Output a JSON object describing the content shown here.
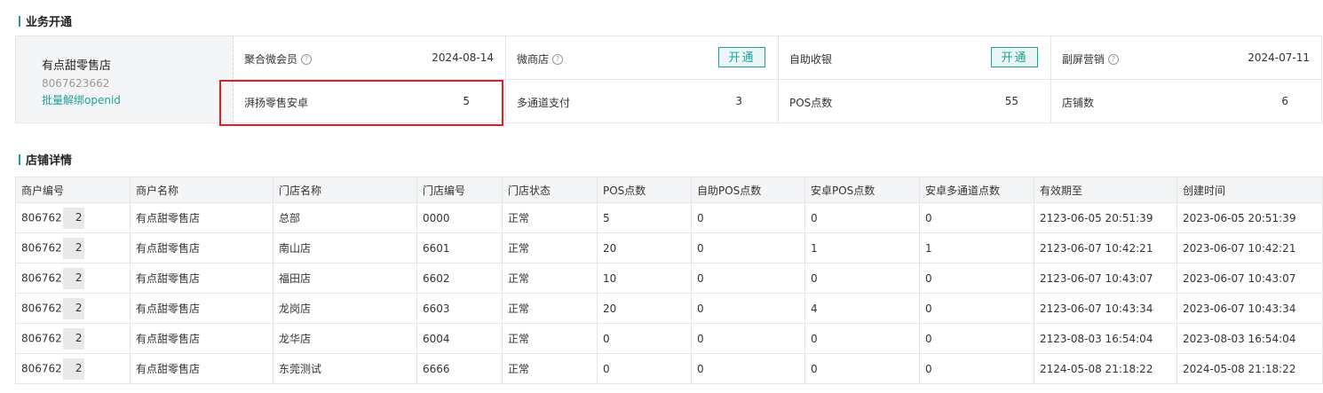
{
  "business": {
    "title": "业务开通",
    "store": {
      "name": "有点甜零售店",
      "id": "8067623662",
      "link": "批量解绑openid"
    },
    "items": [
      {
        "label": "聚合微会员",
        "value": "2024-08-14",
        "help": true
      },
      {
        "label": "微商店",
        "button": "开通",
        "help": true
      },
      {
        "label": "自助收银",
        "button": "开通"
      },
      {
        "label": "副屏营销",
        "value": "2024-07-11",
        "help": true
      },
      {
        "label": "湃扬零售安卓",
        "value": "5"
      },
      {
        "label": "多通道支付",
        "value": "3"
      },
      {
        "label": "POS点数",
        "value": "55"
      },
      {
        "label": "店铺数",
        "value": "6"
      }
    ]
  },
  "details": {
    "title": "店铺详情",
    "columns": [
      "商户编号",
      "商户名称",
      "门店名称",
      "门店编号",
      "门店状态",
      "POS点数",
      "自助POS点数",
      "安卓POS点数",
      "安卓多通道点数",
      "有效期至",
      "创建时间"
    ],
    "rows": [
      {
        "merchant_no": "806762",
        "merchant_no_tail": "2",
        "merchant_name": "有点甜零售店",
        "store_name": "总部",
        "store_no": "0000",
        "status": "正常",
        "pos": "5",
        "self_pos": "0",
        "android_pos": "0",
        "android_multi": "0",
        "valid_until": "2123-06-05 20:51:39",
        "created": "2023-06-05 20:51:39"
      },
      {
        "merchant_no": "806762",
        "merchant_no_tail": "2",
        "merchant_name": "有点甜零售店",
        "store_name": "南山店",
        "store_no": "6601",
        "status": "正常",
        "pos": "20",
        "self_pos": "0",
        "android_pos": "1",
        "android_multi": "1",
        "valid_until": "2123-06-07 10:42:21",
        "created": "2023-06-07 10:42:21"
      },
      {
        "merchant_no": "806762",
        "merchant_no_tail": "2",
        "merchant_name": "有点甜零售店",
        "store_name": "福田店",
        "store_no": "6602",
        "status": "正常",
        "pos": "10",
        "self_pos": "0",
        "android_pos": "0",
        "android_multi": "0",
        "valid_until": "2123-06-07 10:43:07",
        "created": "2023-06-07 10:43:07"
      },
      {
        "merchant_no": "806762",
        "merchant_no_tail": "2",
        "merchant_name": "有点甜零售店",
        "store_name": "龙岗店",
        "store_no": "6603",
        "status": "正常",
        "pos": "20",
        "self_pos": "0",
        "android_pos": "4",
        "android_multi": "0",
        "valid_until": "2123-06-07 10:43:34",
        "created": "2023-06-07 10:43:34"
      },
      {
        "merchant_no": "806762",
        "merchant_no_tail": "2",
        "merchant_name": "有点甜零售店",
        "store_name": "龙华店",
        "store_no": "6004",
        "status": "正常",
        "pos": "0",
        "self_pos": "0",
        "android_pos": "0",
        "android_multi": "0",
        "valid_until": "2123-08-03 16:54:04",
        "created": "2023-08-03 16:54:04"
      },
      {
        "merchant_no": "806762",
        "merchant_no_tail": "2",
        "merchant_name": "有点甜零售店",
        "store_name": "东莞测试",
        "store_no": "6666",
        "status": "正常",
        "pos": "0",
        "self_pos": "0",
        "android_pos": "0",
        "android_multi": "0",
        "valid_until": "2124-05-08 21:18:22",
        "created": "2024-05-08 21:18:22"
      }
    ]
  },
  "colors": {
    "accent": "#1aa39a",
    "highlight": "#e02020",
    "header_bg": "#f4f5f7"
  }
}
